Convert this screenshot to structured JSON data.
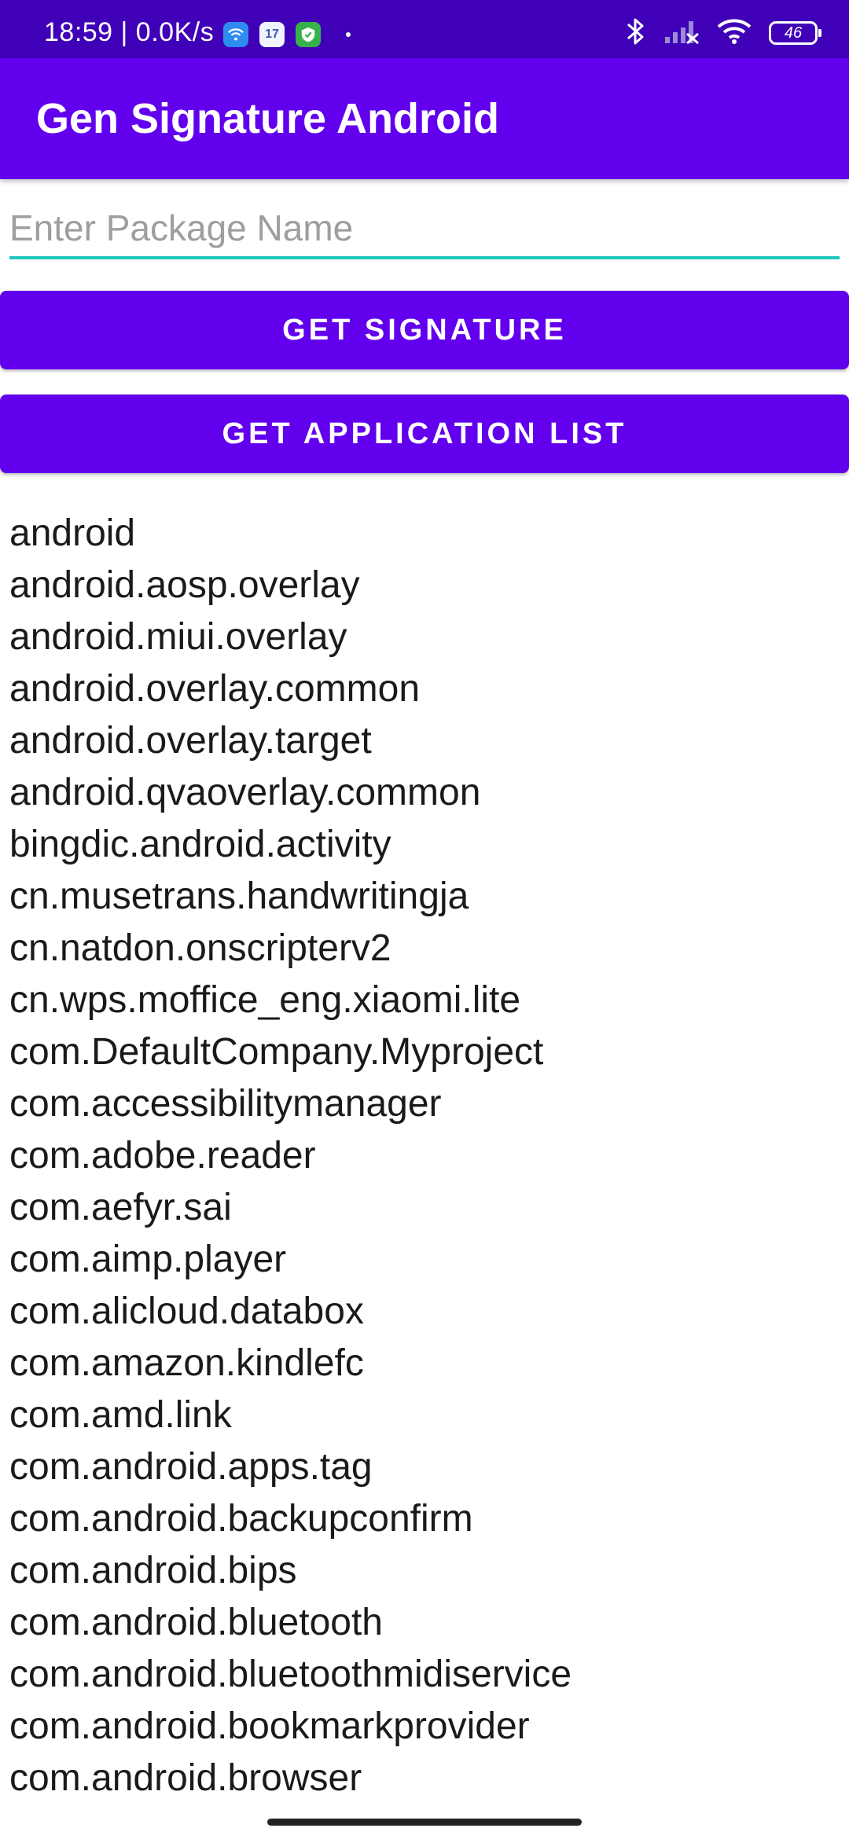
{
  "status_bar": {
    "time": "18:59 | 0.0K/s",
    "calendar_day": "17",
    "battery": "46",
    "icons": [
      "wifi-app-icon",
      "calendar-app-icon",
      "shield-app-icon",
      "bluetooth-icon",
      "cellular-signal-icon",
      "wifi-icon",
      "battery-icon"
    ]
  },
  "app_bar": {
    "title": "Gen Signature Android"
  },
  "package_input": {
    "placeholder": "Enter Package Name",
    "value": ""
  },
  "buttons": {
    "get_signature": "GET SIGNATURE",
    "get_application_list": "GET APPLICATION LIST"
  },
  "packages": [
    "android",
    "android.aosp.overlay",
    "android.miui.overlay",
    "android.overlay.common",
    "android.overlay.target",
    "android.qvaoverlay.common",
    "bingdic.android.activity",
    "cn.musetrans.handwritingja",
    "cn.natdon.onscripterv2",
    "cn.wps.moffice_eng.xiaomi.lite",
    "com.DefaultCompany.Myproject",
    "com.accessibilitymanager",
    "com.adobe.reader",
    "com.aefyr.sai",
    "com.aimp.player",
    "com.alicloud.databox",
    "com.amazon.kindlefc",
    "com.amd.link",
    "com.android.apps.tag",
    "com.android.backupconfirm",
    "com.android.bips",
    "com.android.bluetooth",
    "com.android.bluetoothmidiservice",
    "com.android.bookmarkprovider",
    "com.android.browser"
  ],
  "colors": {
    "status_bar": "#3f00b8",
    "primary": "#6200ee",
    "input_underline": "#1ec8c0",
    "text": "#1a1a1a",
    "placeholder": "#9e9e9e"
  }
}
